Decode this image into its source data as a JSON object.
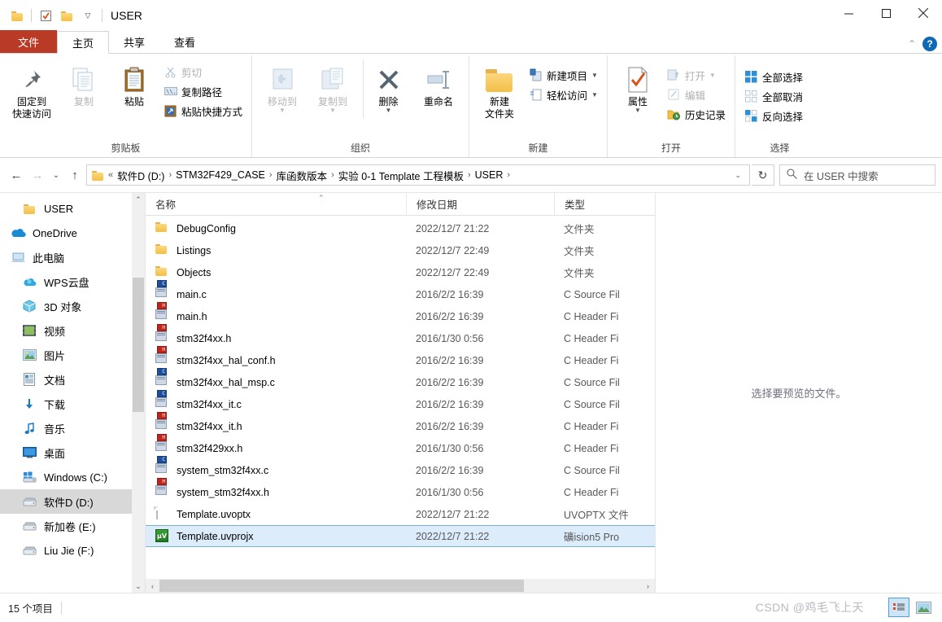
{
  "window": {
    "title": "USER",
    "quick_access": [
      "folder-icon",
      "properties-check-icon",
      "new-folder-icon",
      "customize-caret"
    ],
    "controls": {
      "minimize": "—",
      "maximize": "☐",
      "close": "✕"
    }
  },
  "ribbon": {
    "tabs": [
      {
        "label": "文件",
        "kind": "file"
      },
      {
        "label": "主页",
        "kind": "active"
      },
      {
        "label": "共享",
        "kind": "normal"
      },
      {
        "label": "查看",
        "kind": "normal"
      }
    ],
    "collapse_icon": "⌃",
    "help_label": "?",
    "groups": [
      {
        "label": "剪贴板",
        "big": [
          {
            "label": "固定到\n快速访问",
            "line1": "固定到",
            "line2": "快速访问",
            "icon": "pin-icon",
            "dim": false
          },
          {
            "line1": "复制",
            "line2": "",
            "icon": "copy-icon",
            "dim": true
          },
          {
            "line1": "粘贴",
            "line2": "",
            "icon": "paste-icon",
            "dim": false
          }
        ],
        "small": [
          {
            "label": "剪切",
            "icon": "scissors-icon",
            "dim": true
          },
          {
            "label": "复制路径",
            "icon": "copy-path-icon",
            "dim": false
          },
          {
            "label": "粘贴快捷方式",
            "icon": "paste-shortcut-icon",
            "dim": false
          }
        ]
      },
      {
        "label": "组织",
        "big": [
          {
            "line1": "移动到",
            "line2": "",
            "icon": "move-to-icon",
            "dim": true,
            "caret": true
          },
          {
            "line1": "复制到",
            "line2": "",
            "icon": "copy-to-icon",
            "dim": true,
            "caret": true
          },
          {
            "line1": "删除",
            "line2": "",
            "icon": "delete-x-icon",
            "dim": false,
            "caret": true
          },
          {
            "line1": "重命名",
            "line2": "",
            "icon": "rename-icon",
            "dim": false
          }
        ],
        "small": []
      },
      {
        "label": "新建",
        "big": [
          {
            "line1": "新建",
            "line2": "文件夹",
            "icon": "new-folder-icon",
            "dim": false
          }
        ],
        "small": [
          {
            "label": "新建项目",
            "icon": "new-item-icon",
            "dim": false,
            "caret": true
          },
          {
            "label": "轻松访问",
            "icon": "easy-access-icon",
            "dim": false,
            "caret": true
          }
        ]
      },
      {
        "label": "打开",
        "big": [
          {
            "line1": "属性",
            "line2": "",
            "icon": "properties-icon",
            "dim": false,
            "caret": true
          }
        ],
        "small": [
          {
            "label": "打开",
            "icon": "open-icon",
            "dim": true,
            "caret": true
          },
          {
            "label": "编辑",
            "icon": "edit-icon",
            "dim": true
          },
          {
            "label": "历史记录",
            "icon": "history-icon",
            "dim": false
          }
        ]
      },
      {
        "label": "选择",
        "big": [],
        "small": [
          {
            "label": "全部选择",
            "icon": "select-all-icon",
            "dim": false
          },
          {
            "label": "全部取消",
            "icon": "select-none-icon",
            "dim": false
          },
          {
            "label": "反向选择",
            "icon": "invert-selection-icon",
            "dim": false
          }
        ]
      }
    ]
  },
  "address": {
    "back_icon": "←",
    "forward_icon": "→",
    "recent_icon": "⌄",
    "up_icon": "↑",
    "prefix": "«",
    "crumbs": [
      "软件D (D:)",
      "STM32F429_CASE",
      "库函数版本",
      "实验 0-1 Template 工程模板",
      "USER"
    ],
    "separator": "›",
    "dropdown_icon": "⌄",
    "refresh_icon": "↻"
  },
  "search": {
    "icon": "search-icon",
    "placeholder": "在 USER 中搜索"
  },
  "sidebar": {
    "items": [
      {
        "label": "USER",
        "icon": "folder-icon",
        "indent": true,
        "selected": false
      },
      {
        "label": "OneDrive",
        "icon": "onedrive-icon",
        "indent": false,
        "selected": false
      },
      {
        "label": "此电脑",
        "icon": "this-pc-icon",
        "indent": false,
        "selected": false
      },
      {
        "label": "WPS云盘",
        "icon": "wps-cloud-icon",
        "indent": true,
        "selected": false
      },
      {
        "label": "3D 对象",
        "icon": "3d-objects-icon",
        "indent": true,
        "selected": false
      },
      {
        "label": "视频",
        "icon": "videos-icon",
        "indent": true,
        "selected": false
      },
      {
        "label": "图片",
        "icon": "pictures-icon",
        "indent": true,
        "selected": false
      },
      {
        "label": "文档",
        "icon": "documents-icon",
        "indent": true,
        "selected": false
      },
      {
        "label": "下载",
        "icon": "downloads-icon",
        "indent": true,
        "selected": false
      },
      {
        "label": "音乐",
        "icon": "music-icon",
        "indent": true,
        "selected": false
      },
      {
        "label": "桌面",
        "icon": "desktop-icon",
        "indent": true,
        "selected": false
      },
      {
        "label": "Windows (C:)",
        "icon": "windows-drive-icon",
        "indent": true,
        "selected": false
      },
      {
        "label": "软件D (D:)",
        "icon": "drive-icon",
        "indent": true,
        "selected": true
      },
      {
        "label": "新加卷 (E:)",
        "icon": "drive-icon",
        "indent": true,
        "selected": false
      },
      {
        "label": "Liu Jie  (F:)",
        "icon": "drive-icon",
        "indent": true,
        "selected": false
      }
    ],
    "scroll_up_icon": "⌃",
    "scroll_down_icon": "⌄"
  },
  "filelist": {
    "columns": [
      {
        "label": "名称",
        "sorted": true,
        "sort_icon": "⌃"
      },
      {
        "label": "修改日期",
        "sorted": false
      },
      {
        "label": "类型",
        "sorted": false
      }
    ],
    "rows": [
      {
        "name": "DebugConfig",
        "date": "2022/12/7 21:22",
        "type": "文件夹",
        "icon": "folder-icon",
        "selected": false
      },
      {
        "name": "Listings",
        "date": "2022/12/7 22:49",
        "type": "文件夹",
        "icon": "folder-icon",
        "selected": false
      },
      {
        "name": "Objects",
        "date": "2022/12/7 22:49",
        "type": "文件夹",
        "icon": "folder-icon",
        "selected": false
      },
      {
        "name": "main.c",
        "date": "2016/2/2 16:39",
        "type": "C Source Fil",
        "icon": "c-source-icon",
        "selected": false
      },
      {
        "name": "main.h",
        "date": "2016/2/2 16:39",
        "type": "C Header Fi",
        "icon": "c-header-icon",
        "selected": false
      },
      {
        "name": "stm32f4xx.h",
        "date": "2016/1/30 0:56",
        "type": "C Header Fi",
        "icon": "c-header-icon",
        "selected": false
      },
      {
        "name": "stm32f4xx_hal_conf.h",
        "date": "2016/2/2 16:39",
        "type": "C Header Fi",
        "icon": "c-header-icon",
        "selected": false
      },
      {
        "name": "stm32f4xx_hal_msp.c",
        "date": "2016/2/2 16:39",
        "type": "C Source Fil",
        "icon": "c-source-icon",
        "selected": false
      },
      {
        "name": "stm32f4xx_it.c",
        "date": "2016/2/2 16:39",
        "type": "C Source Fil",
        "icon": "c-source-icon",
        "selected": false
      },
      {
        "name": "stm32f4xx_it.h",
        "date": "2016/2/2 16:39",
        "type": "C Header Fi",
        "icon": "c-header-icon",
        "selected": false
      },
      {
        "name": "stm32f429xx.h",
        "date": "2016/1/30 0:56",
        "type": "C Header Fi",
        "icon": "c-header-icon",
        "selected": false
      },
      {
        "name": "system_stm32f4xx.c",
        "date": "2016/2/2 16:39",
        "type": "C Source Fil",
        "icon": "c-source-icon",
        "selected": false
      },
      {
        "name": "system_stm32f4xx.h",
        "date": "2016/1/30 0:56",
        "type": "C Header Fi",
        "icon": "c-header-icon",
        "selected": false
      },
      {
        "name": "Template.uvoptx",
        "date": "2022/12/7 21:22",
        "type": "UVOPTX 文件",
        "icon": "generic-file-icon",
        "selected": false
      },
      {
        "name": "Template.uvprojx",
        "date": "2022/12/7 21:22",
        "type": "礦ision5 Pro",
        "icon": "keil-project-icon",
        "selected": true
      }
    ],
    "hscroll_left_icon": "‹",
    "hscroll_right_icon": "›"
  },
  "preview": {
    "message": "选择要预览的文件。"
  },
  "status": {
    "item_count": "15 个项目",
    "watermark": "CSDN @鸡毛飞上天",
    "views": [
      {
        "name": "details-view-button",
        "active": true
      },
      {
        "name": "large-icons-view-button",
        "active": false
      }
    ]
  },
  "colors": {
    "file_tab": "#b93a25",
    "selection": "#dcecfb",
    "selection_border": "#7aafd4",
    "sidebar_selected": "#d8d8d8",
    "accent": "#1069b5"
  }
}
